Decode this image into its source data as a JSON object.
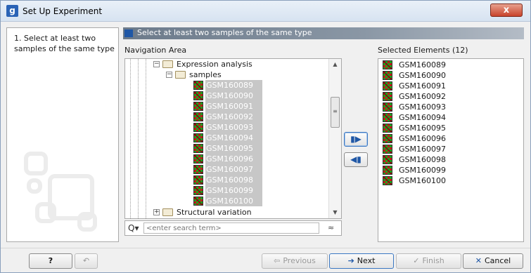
{
  "window": {
    "title": "Set Up Experiment",
    "app_icon": "g",
    "close_glyph": "x"
  },
  "steps": {
    "current": "1. Select at least two\n    samples of the same type"
  },
  "banner": {
    "text": "Select at least two samples of the same type"
  },
  "navigation": {
    "label": "Navigation Area",
    "folders": [
      {
        "label": "Expression analysis",
        "expander": "−"
      },
      {
        "label": "samples",
        "expander": "−"
      },
      {
        "label": "Structural variation",
        "expander": "+"
      }
    ],
    "samples": [
      "GSM160089",
      "GSM160090",
      "GSM160091",
      "GSM160092",
      "GSM160093",
      "GSM160094",
      "GSM160095",
      "GSM160096",
      "GSM160097",
      "GSM160098",
      "GSM160099",
      "GSM160100"
    ]
  },
  "search": {
    "placeholder": "<enter search term>",
    "icon_glyph": "Q▾",
    "collapse_glyph": "≈"
  },
  "transfer": {
    "add_glyph": "▮▶",
    "remove_glyph": "◀▮"
  },
  "selected": {
    "label": "Selected Elements (12)",
    "items": [
      "GSM160089",
      "GSM160090",
      "GSM160091",
      "GSM160092",
      "GSM160093",
      "GSM160094",
      "GSM160095",
      "GSM160096",
      "GSM160097",
      "GSM160098",
      "GSM160099",
      "GSM160100"
    ]
  },
  "buttons": {
    "help": "?",
    "undo_glyph": "↶",
    "previous": "Previous",
    "next": "Next",
    "finish": "Finish",
    "cancel": "Cancel",
    "prev_glyph": "⇦",
    "next_glyph": "➔",
    "finish_glyph": "✓",
    "cancel_glyph": "✕"
  },
  "colors": {
    "accent": "#1f57a6",
    "close": "#c8432b",
    "selection": "#c7c7c7"
  }
}
